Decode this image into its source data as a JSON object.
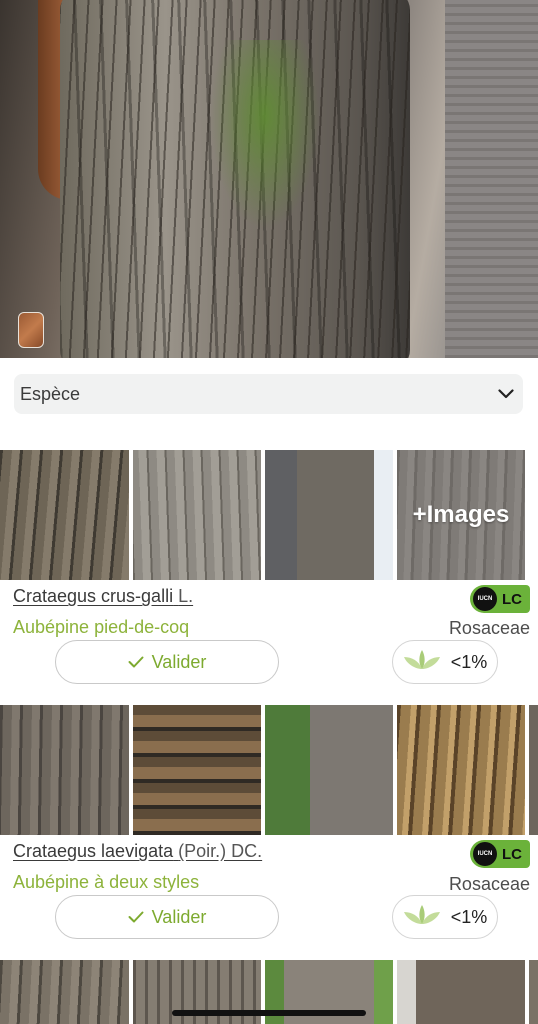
{
  "filter": {
    "value": "Espèce"
  },
  "results": [
    {
      "more_images_label": "+Images",
      "scientific_name": "Crataegus crus-galli",
      "author": "L.",
      "common_name": "Aubépine pied-de-coq",
      "family": "Rosaceae",
      "iucn": {
        "logo_text": "IUCN",
        "code": "LC",
        "color": "#6bb23a"
      },
      "validate_label": "Valider",
      "confidence": "<1%"
    },
    {
      "scientific_name": "Crataegus laevigata",
      "author": "(Poir.) DC.",
      "common_name": "Aubépine à deux styles",
      "family": "Rosaceae",
      "iucn": {
        "logo_text": "IUCN",
        "code": "LC",
        "color": "#6bb23a"
      },
      "validate_label": "Valider",
      "confidence": "<1%"
    }
  ],
  "colors": {
    "accent_green": "#8db33b",
    "validate_green": "#7daa2f",
    "iucn_green": "#6bb23a"
  },
  "icons": [
    "chevron-down-icon",
    "check-icon",
    "leaf-icon"
  ]
}
